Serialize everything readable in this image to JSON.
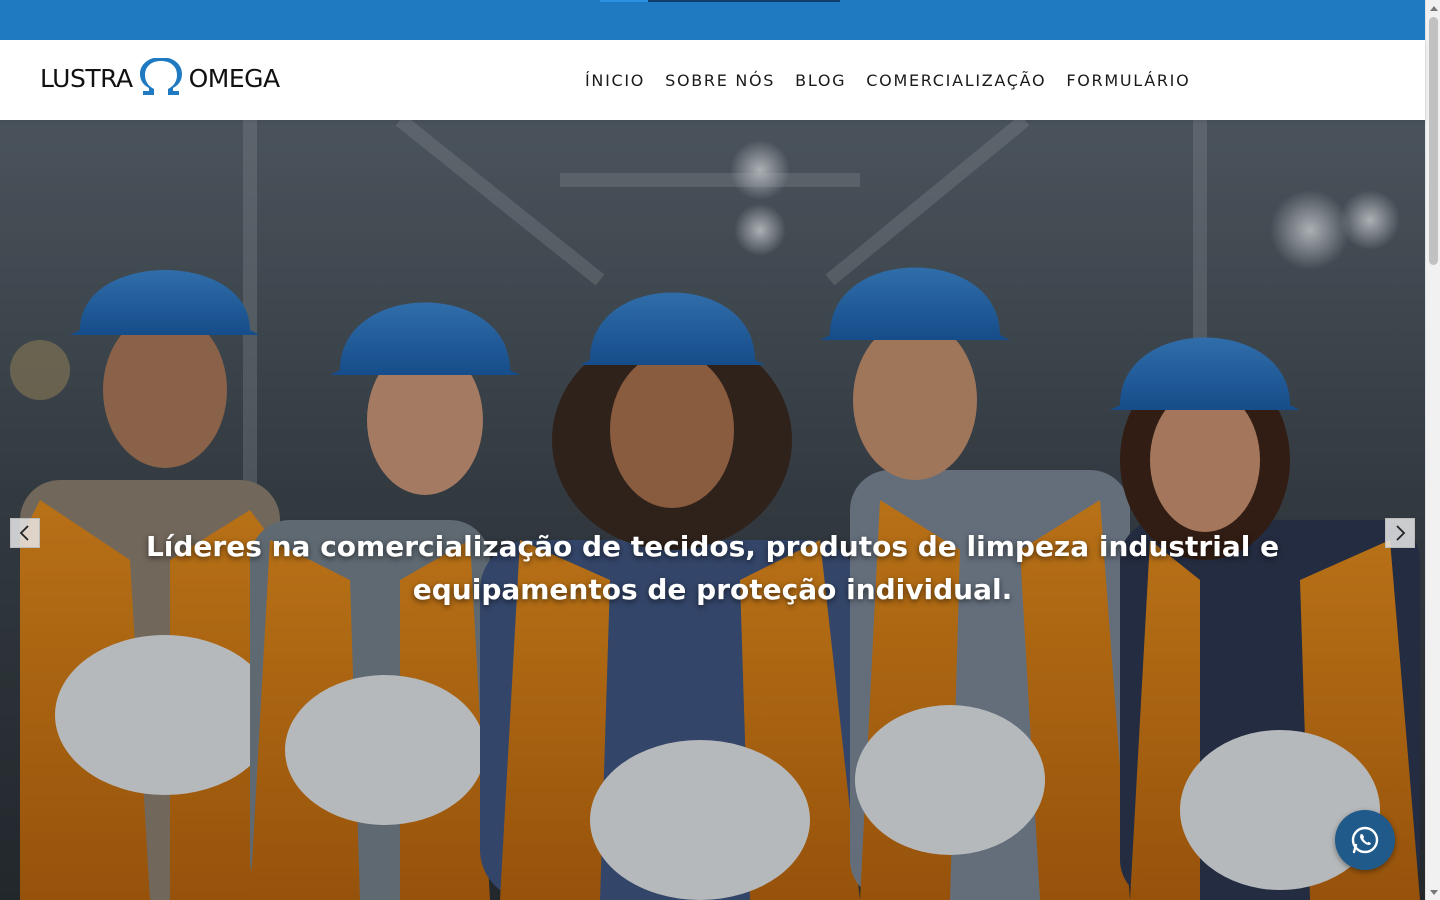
{
  "brand": {
    "name_left": "LUSTRA",
    "name_right": "OMEGA",
    "primary_color": "#1f7ac2",
    "logo_icon": "omega-icon"
  },
  "nav": {
    "items": [
      {
        "label": "ÍNICIO"
      },
      {
        "label": "SOBRE NÓS"
      },
      {
        "label": "BLOG"
      },
      {
        "label": "COMERCIALIZAÇÃO"
      },
      {
        "label": "FORMULÁRIO"
      }
    ]
  },
  "hero": {
    "caption": "Líderes na comercialização de tecidos, produtos de limpeza industrial e equipamentos de proteção individual.",
    "image": "workers-with-blue-hard-hats-and-orange-vests",
    "prev_icon": "chevron-left-icon",
    "next_icon": "chevron-right-icon"
  },
  "floating": {
    "whatsapp_icon": "whatsapp-icon",
    "color": "#1f5a8a"
  }
}
